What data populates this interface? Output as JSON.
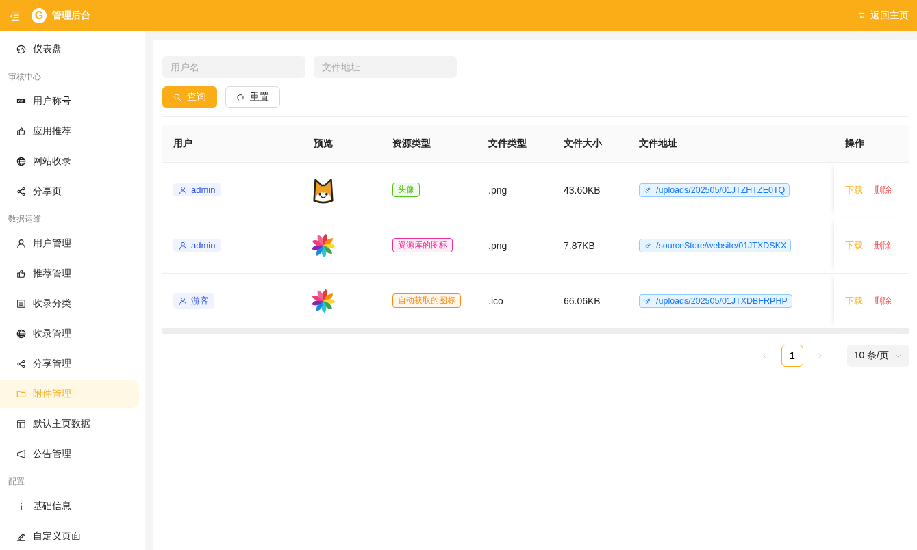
{
  "header": {
    "title": "管理后台",
    "logo_letter": "G",
    "back_link": "返回主页"
  },
  "sidebar": {
    "items": [
      {
        "kind": "item",
        "label": "仪表盘",
        "selected": false
      },
      {
        "kind": "group",
        "label": "审核中心"
      },
      {
        "kind": "item",
        "label": "用户称号",
        "selected": false
      },
      {
        "kind": "item",
        "label": "应用推荐",
        "selected": false
      },
      {
        "kind": "item",
        "label": "网站收录",
        "selected": false
      },
      {
        "kind": "item",
        "label": "分享页",
        "selected": false
      },
      {
        "kind": "group",
        "label": "数据运维"
      },
      {
        "kind": "item",
        "label": "用户管理",
        "selected": false
      },
      {
        "kind": "item",
        "label": "推荐管理",
        "selected": false
      },
      {
        "kind": "item",
        "label": "收录分类",
        "selected": false
      },
      {
        "kind": "item",
        "label": "收录管理",
        "selected": false
      },
      {
        "kind": "item",
        "label": "分享管理",
        "selected": false
      },
      {
        "kind": "item",
        "label": "附件管理",
        "selected": true
      },
      {
        "kind": "item",
        "label": "默认主页数据",
        "selected": false
      },
      {
        "kind": "item",
        "label": "公告管理",
        "selected": false
      },
      {
        "kind": "group",
        "label": "配置"
      },
      {
        "kind": "item",
        "label": "基础信息",
        "selected": false
      },
      {
        "kind": "item",
        "label": "自定义页面",
        "selected": false
      }
    ]
  },
  "filters": [
    {
      "placeholder": "用户名"
    },
    {
      "placeholder": "文件地址"
    }
  ],
  "buttons": [
    {
      "kind": "primary",
      "label": "查询"
    },
    {
      "kind": "default",
      "label": "重置"
    }
  ],
  "table": {
    "columns": [
      "用户",
      "预览",
      "资源类型",
      "文件类型",
      "文件大小",
      "文件地址",
      "操作"
    ],
    "rows": [
      {
        "user": "admin",
        "preview": {
          "kind": "avatar"
        },
        "resource_type": {
          "label": "头像",
          "color": "#52c41a"
        },
        "file_type": ".png",
        "size": "43.60KB",
        "path": "/uploads/202505/01JTZHTZE0TQ",
        "actions": [
          "下载",
          "删除"
        ]
      },
      {
        "user": "admin",
        "preview": {
          "kind": "pinwheel"
        },
        "resource_type": {
          "label": "资源库的图标",
          "color": "#eb2f96"
        },
        "file_type": ".png",
        "size": "7.87KB",
        "path": "/sourceStore/website/01JTXDSKX",
        "actions": [
          "下载",
          "删除"
        ]
      },
      {
        "user": "游客",
        "preview": {
          "kind": "pinwheel"
        },
        "resource_type": {
          "label": "自动获取的图标",
          "color": "#fa8c16"
        },
        "file_type": ".ico",
        "size": "66.06KB",
        "path": "/uploads/202505/01JTXDBFRPHP",
        "actions": [
          "下载",
          "删除"
        ]
      }
    ]
  },
  "pagination": {
    "prev_disabled": true,
    "next_disabled": true,
    "pages": [
      {
        "label": "1",
        "selected": true
      }
    ],
    "page_size": "10 条/页"
  }
}
